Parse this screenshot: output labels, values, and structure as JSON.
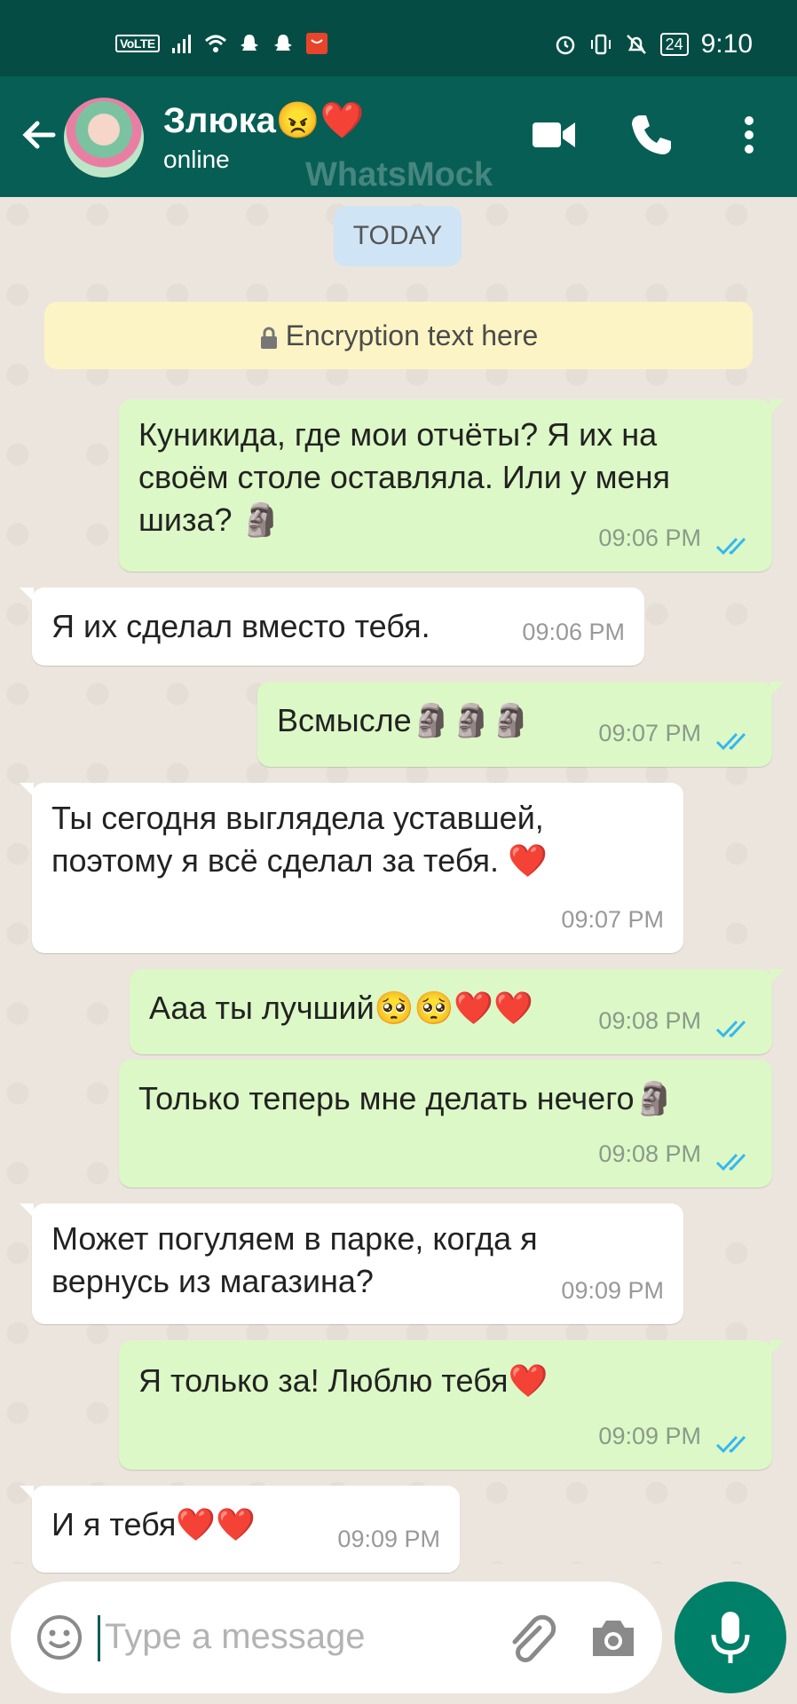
{
  "status_bar": {
    "volte": "VoLTE",
    "battery": "24",
    "time": "9:10"
  },
  "header": {
    "contact_name": "Злюка😠❤️",
    "contact_status": "online",
    "watermark": "WhatsMock"
  },
  "chat": {
    "date_label": "TODAY",
    "encryption_text": "Encryption text here",
    "messages": [
      {
        "direction": "out",
        "text": "Куникида, где мои отчёты? Я их на своём столе оставляла. Или у меня шиза? 🗿",
        "time": "09:06 PM",
        "read": true
      },
      {
        "direction": "in",
        "text": "Я их сделал вместо тебя.",
        "time": "09:06 PM"
      },
      {
        "direction": "out",
        "text": "Всмысле🗿🗿🗿",
        "time": "09:07 PM",
        "read": true
      },
      {
        "direction": "in",
        "text": "Ты сегодня выглядела уставшей, поэтому я всё сделал за тебя. ❤️",
        "time": "09:07 PM"
      },
      {
        "direction": "out",
        "text": "Ааа ты лучший🥺🥺❤️❤️",
        "time": "09:08 PM",
        "read": true
      },
      {
        "direction": "out",
        "text": "Только теперь мне делать нечего🗿",
        "time": "09:08 PM",
        "read": true
      },
      {
        "direction": "in",
        "text": "Может погуляем в парке, когда я вернусь из магазина?",
        "time": "09:09 PM"
      },
      {
        "direction": "out",
        "text": "Я только за! Люблю тебя❤️",
        "time": "09:09 PM",
        "read": true
      },
      {
        "direction": "in",
        "text": "И я тебя❤️❤️",
        "time": "09:09 PM"
      }
    ]
  },
  "composer": {
    "placeholder": "Type a message"
  },
  "colors": {
    "header": "#075e54",
    "status_bar": "#054d44",
    "outgoing": "#dcf8c6",
    "incoming": "#ffffff",
    "ticks": "#34b7f1",
    "mic": "#008069"
  },
  "icons": [
    "back-arrow-icon",
    "video-call-icon",
    "phone-icon",
    "more-vert-icon",
    "lock-icon",
    "double-check-icon",
    "emoji-icon",
    "attach-icon",
    "camera-icon",
    "mic-icon"
  ]
}
